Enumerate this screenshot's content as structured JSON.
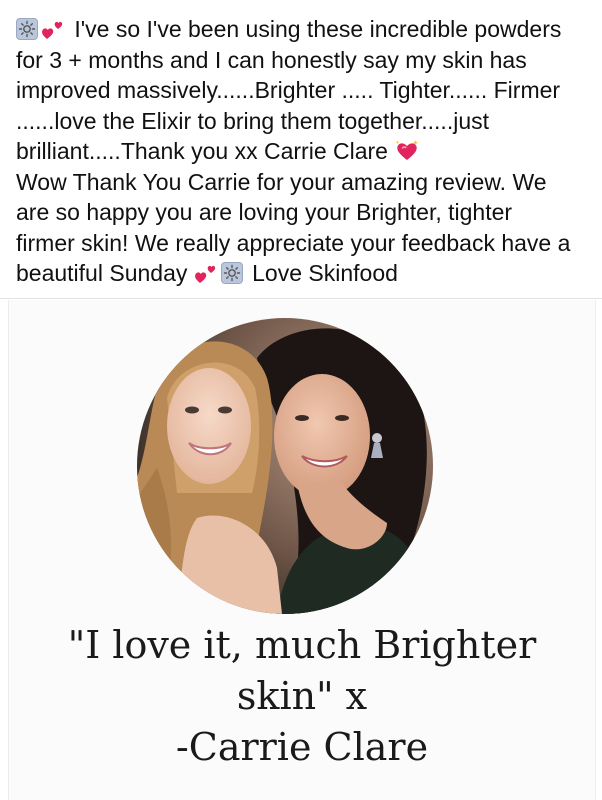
{
  "post": {
    "lines": [
      "I've so I've been using these incredible powders",
      "for 3 + months and I can honestly say my skin has",
      "improved massively......Brighter ..... Tighter...... Firmer",
      "......love the Elixir to bring them together.....just",
      "brilliant.....Thank you xx Carrie Clare",
      "Wow Thank You Carrie for your amazing review. We",
      "are so happy you are loving your Brighter, tighter",
      "firmer skin! We really appreciate your feedback have a",
      "beautiful Sunday",
      "Love Skinfood"
    ],
    "icons": [
      "sun-emoji",
      "two-hearts-emoji",
      "sparkling-heart-emoji"
    ],
    "accent_colors": {
      "heart": "#e0245e",
      "sun_tile": "#b9c6dc"
    }
  },
  "testimonial": {
    "quote_line_1": "\"I love it, much Brighter",
    "quote_line_2": "skin\" x",
    "author": "-Carrie Clare"
  }
}
